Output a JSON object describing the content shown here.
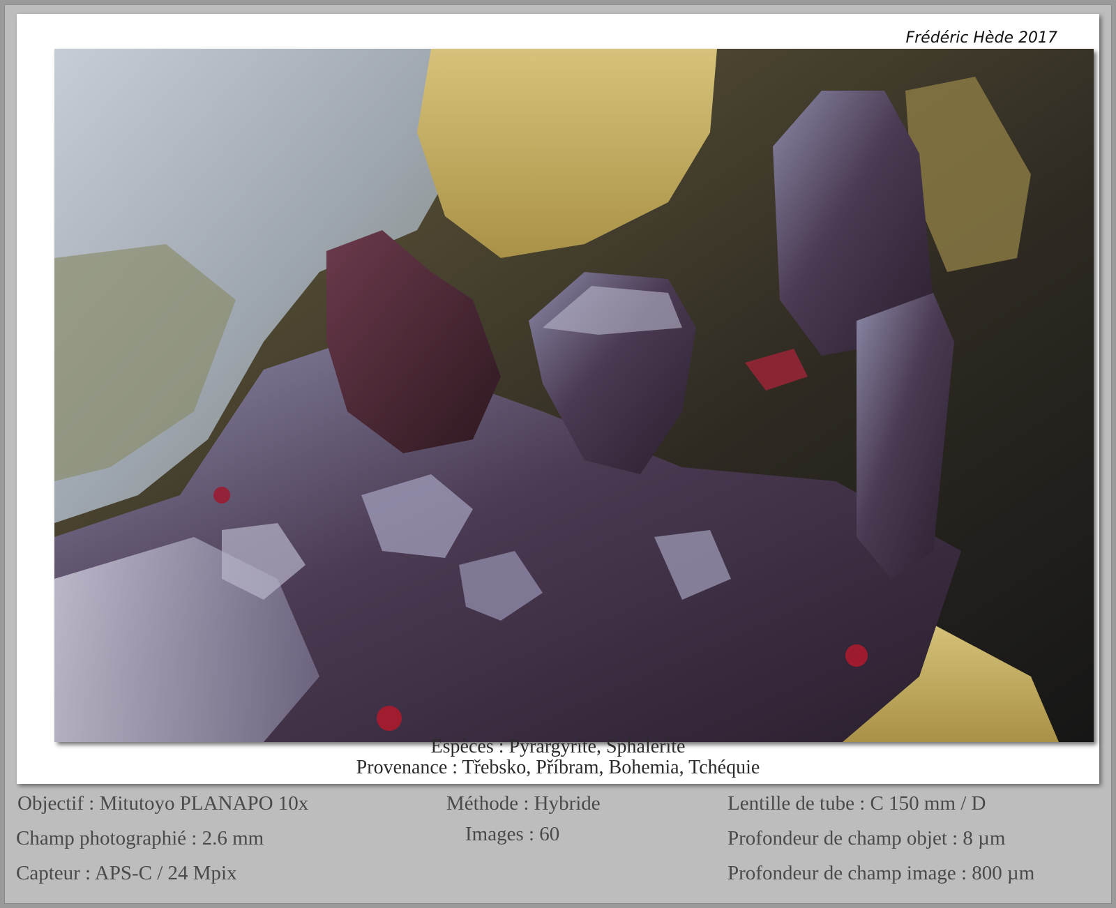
{
  "signature": "Frédéric Hède 2017",
  "caption": {
    "species": "Espèces : Pyrargyrite, Sphalérite",
    "provenance": "Provenance : Třebsko, Příbram, Bohemia, Tchéquie"
  },
  "specs": {
    "objective": "Objectif : Mitutoyo PLANAPO 10x",
    "field": "Champ photographié : 2.6 mm",
    "sensor": "Capteur : APS-C / 24 Mpix",
    "method": "Méthode : Hybride",
    "images": "Images : 60",
    "tube_lens": "Lentille de tube : C 150 mm / D",
    "object_dof": "Profondeur de champ objet : 8 µm",
    "image_dof": "Profondeur de champ image : 800 µm"
  },
  "colors": {
    "background": "#bdbdbd",
    "card": "#ffffff",
    "crystal_dark": "#3a2a3e",
    "crystal_red": "#7a1a2a",
    "matrix_yellow": "#c9b264",
    "matrix_grey": "#9aa3ad"
  }
}
